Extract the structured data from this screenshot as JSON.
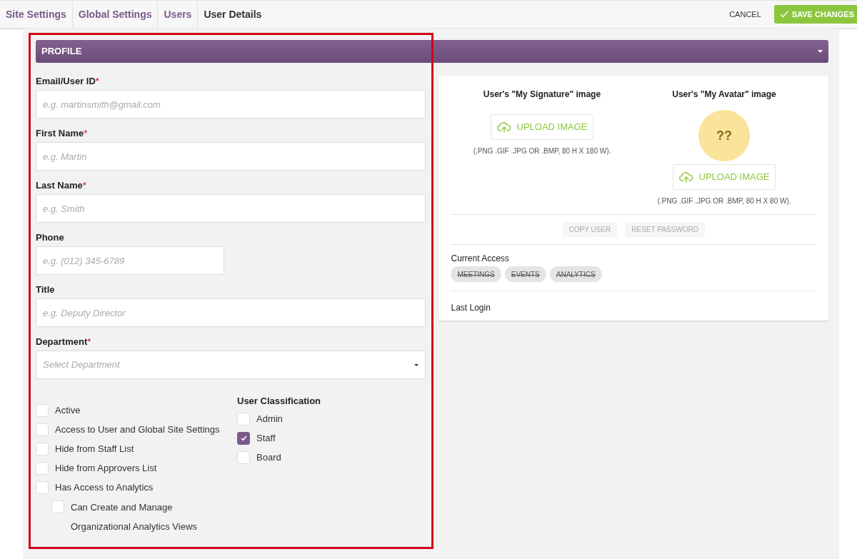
{
  "breadcrumbs": [
    {
      "label": "Site Settings",
      "current": false
    },
    {
      "label": "Global Settings",
      "current": false
    },
    {
      "label": "Users",
      "current": false
    },
    {
      "label": "User Details",
      "current": true
    }
  ],
  "actions": {
    "cancel": "CANCEL",
    "save": "SAVE CHANGES"
  },
  "section": {
    "title": "PROFILE",
    "expanded": true
  },
  "fields": [
    {
      "label": "Email/User ID",
      "required_mark": "*",
      "placeholder": "e.g. martinsmith@gmail.com",
      "kind": "text"
    },
    {
      "label": "First Name",
      "required_mark": "*",
      "placeholder": "e.g. Martin",
      "kind": "text"
    },
    {
      "label": "Last Name",
      "required_mark": "*",
      "placeholder": "e.g. Smith",
      "kind": "text"
    },
    {
      "label": "Phone",
      "placeholder": "e.g. (012) 345-6789",
      "kind": "phone"
    },
    {
      "label": "Title",
      "placeholder": "e.g. Deputy Director",
      "kind": "text"
    },
    {
      "label": "Department",
      "required_mark": "*",
      "placeholder": "Select Department",
      "kind": "select"
    }
  ],
  "options": [
    {
      "label": "Active",
      "checked": false
    },
    {
      "label": "Access to User and Global Site Settings",
      "checked": false
    },
    {
      "label": "Hide from Staff List",
      "checked": false
    },
    {
      "label": "Hide from Approvers List",
      "checked": false
    },
    {
      "label": "Has Access to Analytics",
      "checked": false,
      "children": [
        {
          "label": "Can Create and Manage Organizational Analytics Views",
          "checked": false
        }
      ]
    }
  ],
  "classification": {
    "title": "User Classification",
    "items": [
      {
        "label": "Admin",
        "checked": false
      },
      {
        "label": "Staff",
        "checked": true
      },
      {
        "label": "Board",
        "checked": false
      }
    ]
  },
  "images": [
    {
      "title": "User's \"My Signature\" image",
      "kind": "signature",
      "button": "UPLOAD IMAGE",
      "hint": "(.PNG .GIF .JPG OR .BMP, 80 H X 180 W)."
    },
    {
      "title": "User's \"My Avatar\" image",
      "kind": "avatar",
      "avatar_text": "??",
      "button": "UPLOAD IMAGE",
      "hint": "(.PNG .GIF .JPG OR .BMP, 80 H X 80 W)."
    }
  ],
  "user_buttons": [
    {
      "label": "COPY USER",
      "disabled": true
    },
    {
      "label": "RESET PASSWORD",
      "disabled": true
    }
  ],
  "current_access": {
    "title": "Current Access",
    "tags": [
      {
        "label": "MEETINGS",
        "granted": false
      },
      {
        "label": "EVENTS",
        "granted": false
      },
      {
        "label": "ANALYTICS",
        "granted": false
      }
    ]
  },
  "last_login": {
    "label": "Last Login"
  }
}
